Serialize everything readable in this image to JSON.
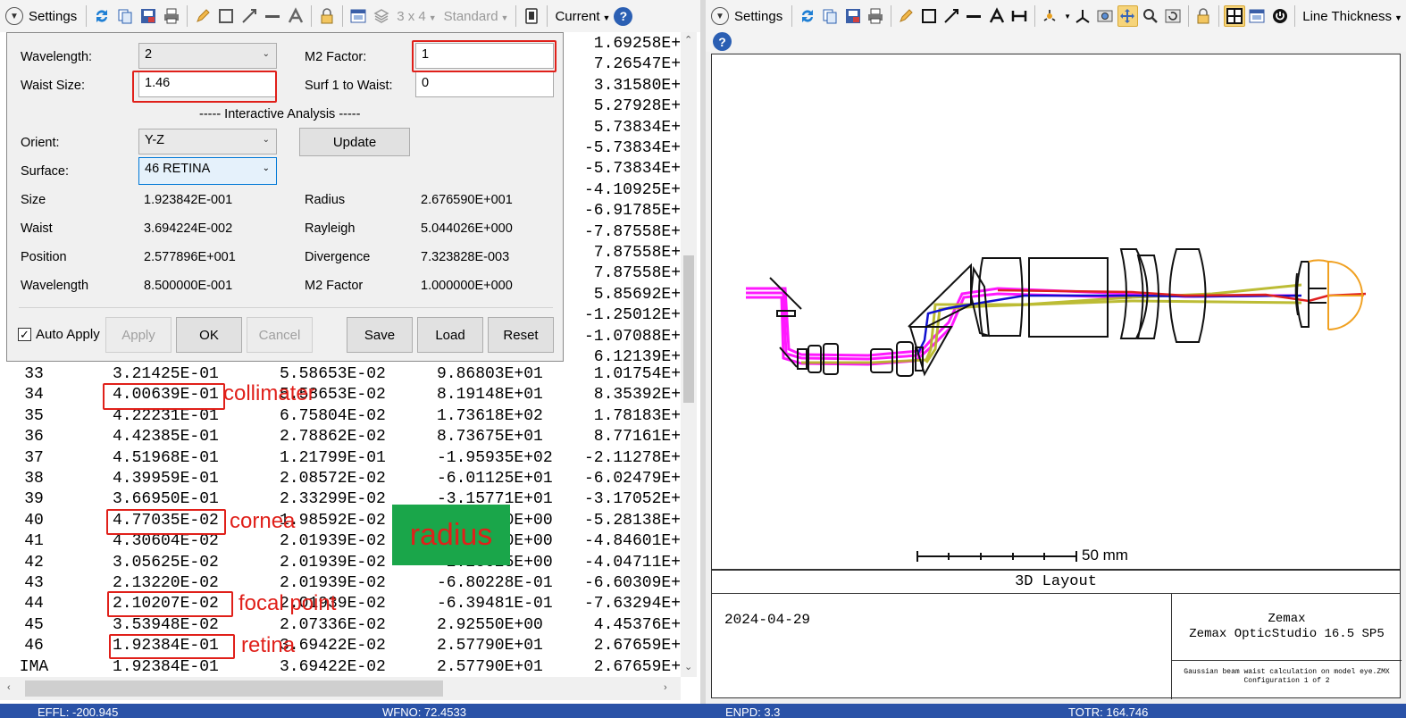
{
  "left_toolbar": {
    "settings_label": "Settings",
    "grid_label": "3 x 4",
    "standard_label": "Standard",
    "current_label": "Current"
  },
  "dialog": {
    "wavelength_label": "Wavelength:",
    "wavelength_value": "2",
    "m2_label": "M2 Factor:",
    "m2_value": "1",
    "waist_size_label": "Waist Size:",
    "waist_size_value": "1.46",
    "surf_to_waist_label": "Surf 1 to Waist:",
    "surf_to_waist_value": "0",
    "section_title": "----- Interactive Analysis -----",
    "orient_label": "Orient:",
    "orient_value": "Y-Z",
    "update_label": "Update",
    "surface_label": "Surface:",
    "surface_value": "46 RETINA",
    "results": [
      {
        "label": "Size",
        "value": "1.923842E-001",
        "label2": "Radius",
        "value2": "2.676590E+001"
      },
      {
        "label": "Waist",
        "value": "3.694224E-002",
        "label2": "Rayleigh",
        "value2": "5.044026E+000"
      },
      {
        "label": "Position",
        "value": "2.577896E+001",
        "label2": "Divergence",
        "value2": "7.323828E-003"
      },
      {
        "label": "Wavelength",
        "value": "8.500000E-001",
        "label2": "M2 Factor",
        "value2": "1.000000E+000"
      }
    ],
    "auto_apply_label": "Auto Apply",
    "apply_label": "Apply",
    "ok_label": "OK",
    "cancel_label": "Cancel",
    "save_label": "Save",
    "load_label": "Load",
    "reset_label": "Reset"
  },
  "column4_top": [
    "1.69258E+",
    "7.26547E+",
    "3.31580E+",
    "5.27928E+",
    "5.73834E+",
    "-5.73834E+",
    "-5.73834E+",
    "-4.10925E+",
    "-6.91785E+",
    "-7.87558E+",
    "7.87558E+",
    "7.87558E+",
    "5.85692E+",
    "-1.25012E+",
    "-1.07088E+",
    "6.12139E+"
  ],
  "rows": [
    {
      "surf": "33",
      "c1": "3.21425E-01",
      "c2": "5.58653E-02",
      "c3": "9.86803E+01",
      "c4": "1.01754E+"
    },
    {
      "surf": "34",
      "c1": "4.00639E-01",
      "c2": "5.58653E-02",
      "c3": "8.19148E+01",
      "c4": "8.35392E+"
    },
    {
      "surf": "35",
      "c1": "4.22231E-01",
      "c2": "6.75804E-02",
      "c3": "1.73618E+02",
      "c4": "1.78183E+"
    },
    {
      "surf": "36",
      "c1": "4.42385E-01",
      "c2": "2.78862E-02",
      "c3": "8.73675E+01",
      "c4": "8.77161E+"
    },
    {
      "surf": "37",
      "c1": "4.51968E-01",
      "c2": "1.21799E-01",
      "c3": "-1.95935E+02",
      "c4": "-2.11278E+"
    },
    {
      "surf": "38",
      "c1": "4.39959E-01",
      "c2": "2.08572E-02",
      "c3": "-6.01125E+01",
      "c4": "-6.02479E+"
    },
    {
      "surf": "39",
      "c1": "3.66950E-01",
      "c2": "2.33299E-02",
      "c3": "-3.15771E+01",
      "c4": "-3.17052E+"
    },
    {
      "surf": "40",
      "c1": "4.77035E-02",
      "c2": "1.98592E-02",
      "c3": "-5.25000E+00",
      "c4": "-5.28138E+"
    },
    {
      "surf": "41",
      "c1": "4.30604E-02",
      "c2": "2.01939E-02",
      "c3": "-4.80000E+00",
      "c4": "-4.84601E+"
    },
    {
      "surf": "42",
      "c1": "3.05625E-02",
      "c2": "2.01939E-02",
      "c3": "-2.28025E+00",
      "c4": "-4.04711E+"
    },
    {
      "surf": "43",
      "c1": "2.13220E-02",
      "c2": "2.01939E-02",
      "c3": "-6.80228E-01",
      "c4": "-6.60309E+"
    },
    {
      "surf": "44",
      "c1": "2.10207E-02",
      "c2": "2.01939E-02",
      "c3": "-6.39481E-01",
      "c4": "-7.63294E+"
    },
    {
      "surf": "45",
      "c1": "3.53948E-02",
      "c2": "2.07336E-02",
      "c3": "2.92550E+00",
      "c4": "4.45376E+"
    },
    {
      "surf": "46",
      "c1": "1.92384E-01",
      "c2": "3.69422E-02",
      "c3": "2.57790E+01",
      "c4": "2.67659E+"
    },
    {
      "surf": "IMA",
      "c1": "1.92384E-01",
      "c2": "3.69422E-02",
      "c3": "2.57790E+01",
      "c4": "2.67659E+"
    }
  ],
  "annotations": {
    "collimater": "collimater",
    "cornea": "cornea",
    "radius": "radius",
    "focal_point": "focal point",
    "retina": "retina"
  },
  "right_toolbar": {
    "settings_label": "Settings",
    "line_thickness_label": "Line Thickness"
  },
  "layout": {
    "scale_label": "50 mm",
    "title": "3D Layout",
    "date": "2024-04-29",
    "company": "Zemax",
    "product": "Zemax OpticStudio 16.5 SP5",
    "file_line1": "Gaussian beam waist calculation on model eye.ZMX",
    "file_line2": "Configuration 1 of 2",
    "colors": {
      "magenta": "#ff00ff",
      "blue": "#1010d0",
      "olive": "#b5b520",
      "red": "#e02020",
      "orange": "#f0a020"
    }
  },
  "status": {
    "effl": "EFFL: -200.945",
    "wfno": "WFNO: 72.4533",
    "enpd": "ENPD: 3.3",
    "totr": "TOTR: 164.746"
  }
}
